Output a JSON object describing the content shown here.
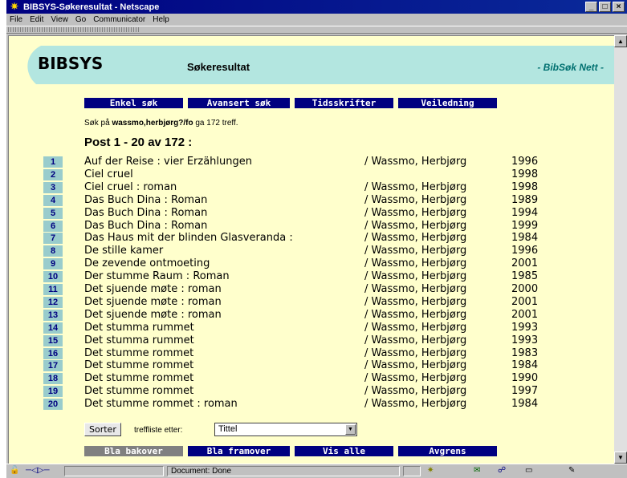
{
  "window": {
    "title": "BIBSYS-Søkeresultat - Netscape",
    "controls": {
      "minimize": "_",
      "maximize": "□",
      "close": "×"
    }
  },
  "menu": [
    "File",
    "Edit",
    "View",
    "Go",
    "Communicator",
    "Help"
  ],
  "header": {
    "logo": "BIBSYS",
    "heading": "Søkeresultat",
    "tagline": "- BibSøk Nett -"
  },
  "nav": [
    {
      "label": "Enkel søk"
    },
    {
      "label": "Avansert søk"
    },
    {
      "label": "Tidsskrifter"
    },
    {
      "label": "Veiledning"
    }
  ],
  "summary": {
    "prefix": "Søk på ",
    "query": "wassmo,herbjørg?/fo",
    "suffix": " ga 172 treff."
  },
  "post_heading": "Post 1 - 20 av 172 :",
  "results": [
    {
      "n": "1",
      "title": "Auf der Reise : vier Erzählungen",
      "author": "/ Wassmo, Herbjørg",
      "year": "1996"
    },
    {
      "n": "2",
      "title": "Ciel cruel",
      "author": "",
      "year": "1998"
    },
    {
      "n": "3",
      "title": "Ciel cruel : roman",
      "author": "/ Wassmo, Herbjørg",
      "year": "1998"
    },
    {
      "n": "4",
      "title": "Das Buch Dina : Roman",
      "author": "/ Wassmo, Herbjørg",
      "year": "1989"
    },
    {
      "n": "5",
      "title": "Das Buch Dina : Roman",
      "author": "/ Wassmo, Herbjørg",
      "year": "1994"
    },
    {
      "n": "6",
      "title": "Das Buch Dina : Roman",
      "author": "/ Wassmo, Herbjørg",
      "year": "1999"
    },
    {
      "n": "7",
      "title": "Das Haus mit der blinden Glasveranda :",
      "author": "/ Wassmo, Herbjørg",
      "year": "1984"
    },
    {
      "n": "8",
      "title": "De stille kamer",
      "author": "/ Wassmo, Herbjørg",
      "year": "1996"
    },
    {
      "n": "9",
      "title": "De zevende ontmoeting",
      "author": "/ Wassmo, Herbjørg",
      "year": "2001"
    },
    {
      "n": "10",
      "title": "Der stumme Raum : Roman",
      "author": "/ Wassmo, Herbjørg",
      "year": "1985"
    },
    {
      "n": "11",
      "title": "Det sjuende møte : roman",
      "author": "/ Wassmo, Herbjørg",
      "year": "2000"
    },
    {
      "n": "12",
      "title": "Det sjuende møte : roman",
      "author": "/ Wassmo, Herbjørg",
      "year": "2001"
    },
    {
      "n": "13",
      "title": "Det sjuende møte : roman",
      "author": "/ Wassmo, Herbjørg",
      "year": "2001"
    },
    {
      "n": "14",
      "title": "Det stumma rummet",
      "author": "/ Wassmo, Herbjørg",
      "year": "1993"
    },
    {
      "n": "15",
      "title": "Det stumma rummet",
      "author": "/ Wassmo, Herbjørg",
      "year": "1993"
    },
    {
      "n": "16",
      "title": "Det stumme rommet",
      "author": "/ Wassmo, Herbjørg",
      "year": "1983"
    },
    {
      "n": "17",
      "title": "Det stumme rommet",
      "author": "/ Wassmo, Herbjørg",
      "year": "1984"
    },
    {
      "n": "18",
      "title": "Det stumme rommet",
      "author": "/ Wassmo, Herbjørg",
      "year": "1990"
    },
    {
      "n": "19",
      "title": "Det stumme rommet",
      "author": "/ Wassmo, Herbjørg",
      "year": "1997"
    },
    {
      "n": "20",
      "title": "Det stumme rommet : roman",
      "author": "/ Wassmo, Herbjørg",
      "year": "1984"
    }
  ],
  "sort": {
    "button": "Sorter",
    "label": "treffliste etter:",
    "selected": "Tittel"
  },
  "bottom_nav": [
    {
      "label": "Bla bakover",
      "color": "#808080"
    },
    {
      "label": "Bla framover",
      "color": "#000080"
    },
    {
      "label": "Vis alle",
      "color": "#000080"
    },
    {
      "label": "Avgrens",
      "color": "#000080"
    }
  ],
  "status": {
    "text": "Document: Done"
  },
  "colors": {
    "page_background": "#ffffcc",
    "header_band": "#b3e6e0",
    "nav_button": "#000080",
    "number_cell": "#99cccc"
  }
}
